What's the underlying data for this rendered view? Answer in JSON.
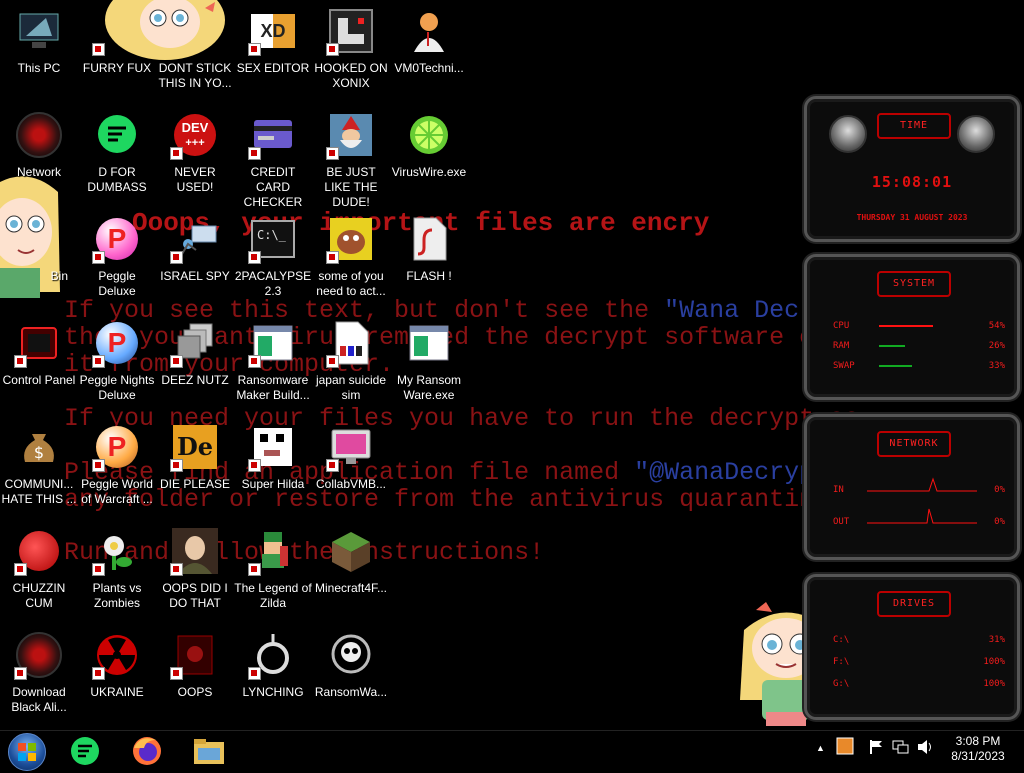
{
  "wallpaper": {
    "line1": "Ooops, your important files are encry",
    "line2a": "If you see this text, but don't see the ",
    "line2b": "\"Wana Decrypt",
    "line3": "then your antivirus removed the decrypt software or",
    "line4": "it from your computer.",
    "line5": "If you need your files you have to run the decrypt so",
    "line6a": "Please find an application file named ",
    "line6b": "\"@WanaDecrypto",
    "line7": "any folder or restore from the antivirus quarantine.",
    "line8": "Run and follow the instructions!"
  },
  "icons": [
    {
      "label": "This PC"
    },
    {
      "label": "FURRY FUX"
    },
    {
      "label": "DONT STICK THIS IN YO..."
    },
    {
      "label": "SEX EDITOR"
    },
    {
      "label": "HOOKED ON XONIX"
    },
    {
      "label": "VM0Techni..."
    },
    {
      "label": "Network"
    },
    {
      "label": "D FOR DUMBASS"
    },
    {
      "label": "NEVER USED!"
    },
    {
      "label": "CREDIT CARD CHECKER"
    },
    {
      "label": "BE JUST LIKE THE DUDE!"
    },
    {
      "label": "VirusWire.exe"
    },
    {
      "label": "Bin"
    },
    {
      "label": "Peggle Deluxe"
    },
    {
      "label": "ISRAEL SPY"
    },
    {
      "label": "2PACALYPSE 2.3"
    },
    {
      "label": "some of you need to act..."
    },
    {
      "label": "FLASH !"
    },
    {
      "label": "Control Panel"
    },
    {
      "label": "Peggle Nights Deluxe"
    },
    {
      "label": "DEEZ NUTZ"
    },
    {
      "label": "Ransomware Maker Build..."
    },
    {
      "label": "japan suicide sim"
    },
    {
      "label": "My Ransom Ware.exe"
    },
    {
      "label": "COMMUNI... HATE THIS ..."
    },
    {
      "label": "Peggle World of Warcraft ..."
    },
    {
      "label": "DIE PLEASE"
    },
    {
      "label": "Super Hilda"
    },
    {
      "label": "CollabVMB..."
    },
    {
      "label": "CHUZZIN CUM"
    },
    {
      "label": "Plants vs Zombies"
    },
    {
      "label": "OOPS DID I DO THAT"
    },
    {
      "label": "The Legend of Zilda"
    },
    {
      "label": "Minecraft4F..."
    },
    {
      "label": "Download Black Ali..."
    },
    {
      "label": "UKRAINE"
    },
    {
      "label": "OOPS"
    },
    {
      "label": "LYNCHING"
    },
    {
      "label": "RansomWa..."
    }
  ],
  "icon_text": {
    "dev": "DEV",
    "dev_plus": "+++",
    "peggle_p": "P",
    "de": "De",
    "cmd": "C:\\_",
    "xd": "XD"
  },
  "widget": {
    "time_title": "TIME",
    "time": "15:08:01",
    "date": "THURSDAY 31 AUGUST 2023",
    "system_title": "SYSTEM",
    "cpu_label": "CPU",
    "cpu_pct": "54%",
    "cpu_value": 54,
    "ram_label": "RAM",
    "ram_pct": "26%",
    "ram_value": 26,
    "swap_label": "SWAP",
    "swap_pct": "33%",
    "swap_value": 33,
    "network_title": "NETWORK",
    "in_label": "IN",
    "in_pct": "0%",
    "out_label": "OUT",
    "out_pct": "0%",
    "drives_title": "DRIVES",
    "drive_c": "C:\\",
    "drive_c_pct": "31%",
    "drive_f": "F:\\",
    "drive_f_pct": "100%",
    "drive_g": "G:\\",
    "drive_g_pct": "100%",
    "colors": {
      "accent": "#f21c1c"
    }
  },
  "taskbar": {
    "time": "3:08 PM",
    "date": "8/31/2023",
    "tray_arrow": "▲"
  }
}
